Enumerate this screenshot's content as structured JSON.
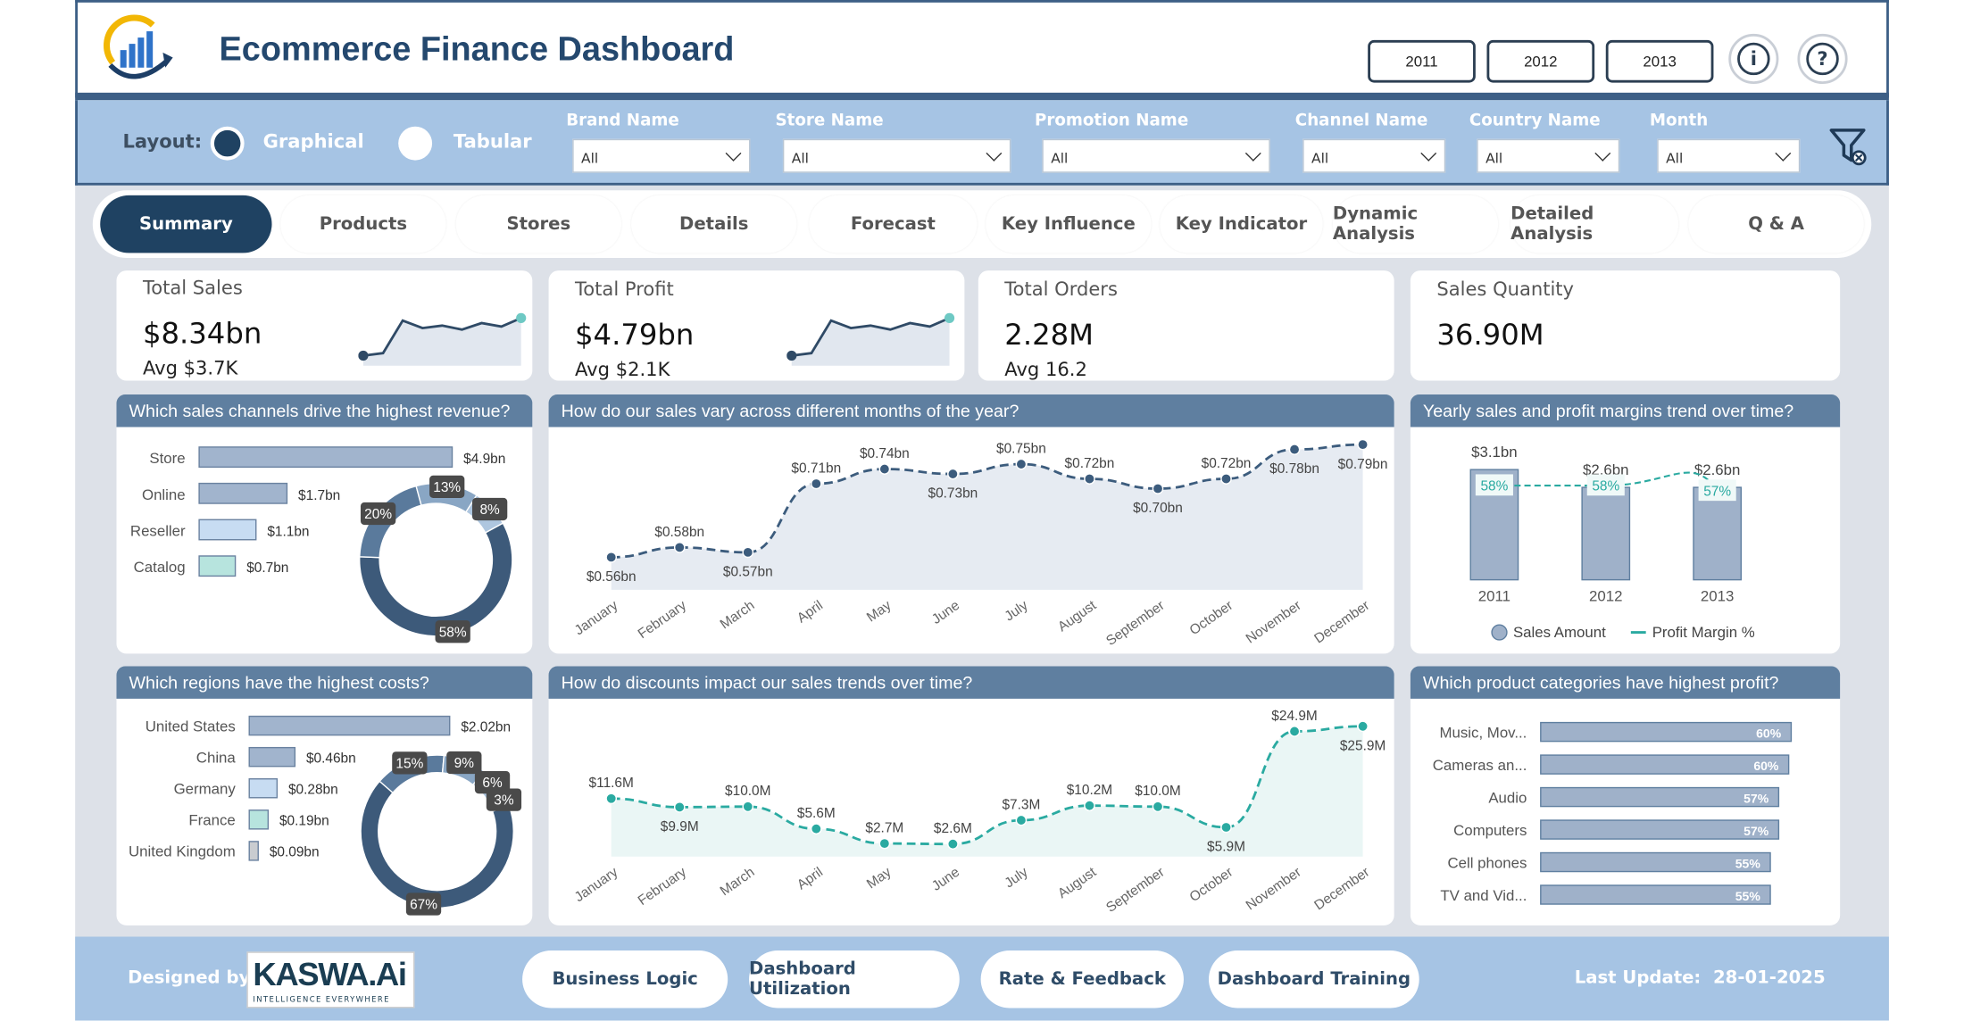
{
  "title": "Ecommerce Finance Dashboard",
  "years": [
    "2011",
    "2012",
    "2013"
  ],
  "icons": {
    "info": "i",
    "help": "?"
  },
  "layout": {
    "label": "Layout:",
    "graphical": "Graphical",
    "tabular": "Tabular"
  },
  "filters": [
    {
      "label": "Brand Name",
      "value": "All"
    },
    {
      "label": "Store Name",
      "value": "All"
    },
    {
      "label": "Promotion Name",
      "value": "All"
    },
    {
      "label": "Channel Name",
      "value": "All"
    },
    {
      "label": "Country Name",
      "value": "All"
    },
    {
      "label": "Month",
      "value": "All"
    }
  ],
  "tabs": [
    "Summary",
    "Products",
    "Stores",
    "Details",
    "Forecast",
    "Key Influence",
    "Key Indicator",
    "Dynamic Analysis",
    "Detailed Analysis",
    "Q & A"
  ],
  "kpis": [
    {
      "title": "Total Sales",
      "value": "$8.34bn",
      "avg_label": "Avg",
      "avg": "$3.7K"
    },
    {
      "title": "Total Profit",
      "value": "$4.79bn",
      "avg_label": "Avg",
      "avg": "$2.1K"
    },
    {
      "title": "Total Orders",
      "value": "2.28M",
      "avg_label": "Avg",
      "avg": "16.2"
    },
    {
      "title": "Sales Quantity",
      "value": "36.90M"
    }
  ],
  "panels": {
    "channels": "Which sales channels drive the highest revenue?",
    "months": "How do our sales vary across different months of the year?",
    "yearly": "Yearly sales and profit margins trend over time?",
    "regions": "Which regions have the highest costs?",
    "discounts": "How do discounts impact our sales trends over time?",
    "categories": "Which product categories have highest profit?"
  },
  "chart_data": [
    {
      "type": "bar",
      "id": "channels",
      "categories": [
        "Store",
        "Online",
        "Reseller",
        "Catalog"
      ],
      "values": [
        4.9,
        1.7,
        1.1,
        0.7
      ],
      "labels": [
        "$4.9bn",
        "$1.7bn",
        "$1.1bn",
        "$0.7bn"
      ],
      "colors": [
        "#a1b4cd",
        "#a1b4cd",
        "#c7dcf2",
        "#b7e4de"
      ]
    },
    {
      "type": "pie",
      "id": "channels-donut",
      "values": [
        58,
        20,
        13,
        8
      ],
      "labels": [
        "58%",
        "20%",
        "13%",
        "8%"
      ],
      "colors": [
        "#3d5a7a",
        "#5a7a9c",
        "#89a6c4",
        "#aec6df"
      ]
    },
    {
      "type": "area",
      "id": "months",
      "categories": [
        "January",
        "February",
        "March",
        "April",
        "May",
        "June",
        "July",
        "August",
        "September",
        "October",
        "November",
        "December"
      ],
      "values": [
        0.56,
        0.58,
        0.57,
        0.71,
        0.74,
        0.73,
        0.75,
        0.72,
        0.7,
        0.72,
        0.78,
        0.79
      ],
      "labels": [
        "$0.56bn",
        "$0.58bn",
        "$0.57bn",
        "$0.71bn",
        "$0.74bn",
        "$0.73bn",
        "$0.75bn",
        "$0.72bn",
        "$0.70bn",
        "$0.72bn",
        "$0.78bn",
        "$0.79bn"
      ]
    },
    {
      "type": "bar",
      "id": "yearly",
      "categories": [
        "2011",
        "2012",
        "2013"
      ],
      "series": [
        {
          "name": "Sales Amount",
          "values": [
            3.1,
            2.6,
            2.6
          ],
          "labels": [
            "$3.1bn",
            "$2.6bn",
            "$2.6bn"
          ]
        },
        {
          "name": "Profit Margin %",
          "values": [
            58,
            58,
            57
          ],
          "labels": [
            "58%",
            "58%",
            "57%"
          ]
        }
      ]
    },
    {
      "type": "bar",
      "id": "regions",
      "categories": [
        "United States",
        "China",
        "Germany",
        "France",
        "United Kingdom"
      ],
      "values": [
        2.02,
        0.46,
        0.28,
        0.19,
        0.09
      ],
      "labels": [
        "$2.02bn",
        "$0.46bn",
        "$0.28bn",
        "$0.19bn",
        "$0.09bn"
      ],
      "colors": [
        "#a1b4cd",
        "#a1b4cd",
        "#c7dcf2",
        "#b7e4de",
        "#c9ccd0"
      ]
    },
    {
      "type": "pie",
      "id": "regions-donut",
      "values": [
        67,
        15,
        9,
        6,
        3
      ],
      "labels": [
        "67%",
        "15%",
        "9%",
        "6%",
        "3%"
      ],
      "colors": [
        "#3d5a7a",
        "#5a7a9c",
        "#89a6c4",
        "#aec6df",
        "#c8dbee"
      ]
    },
    {
      "type": "area",
      "id": "discounts",
      "categories": [
        "January",
        "February",
        "March",
        "April",
        "May",
        "June",
        "July",
        "August",
        "September",
        "October",
        "November",
        "December"
      ],
      "values": [
        11.6,
        9.9,
        10.0,
        5.6,
        2.7,
        2.6,
        7.3,
        10.2,
        10.0,
        5.9,
        24.9,
        25.9
      ],
      "labels": [
        "$11.6M",
        "$9.9M",
        "$10.0M",
        "$5.6M",
        "$2.7M",
        "$2.6M",
        "$7.3M",
        "$10.2M",
        "$10.0M",
        "$5.9M",
        "$24.9M",
        "$25.9M"
      ]
    },
    {
      "type": "bar",
      "id": "categories",
      "categories": [
        "Music, Mov...",
        "Cameras an...",
        "Audio",
        "Computers",
        "Cell phones",
        "TV and Vid..."
      ],
      "values": [
        60,
        60,
        57,
        57,
        55,
        55
      ],
      "labels": [
        "60%",
        "60%",
        "57%",
        "57%",
        "55%",
        "55%"
      ]
    }
  ],
  "sparklines": {
    "sales": [
      0.2,
      0.25,
      0.9,
      0.75,
      0.8,
      0.72,
      0.85,
      0.78,
      0.95
    ],
    "profit": [
      0.2,
      0.25,
      0.9,
      0.75,
      0.8,
      0.72,
      0.85,
      0.78,
      0.95
    ]
  },
  "footer": {
    "designed_by": "Designed by:",
    "brand": "KASWA.Ai",
    "tagline": "INTELLIGENCE EVERYWHERE",
    "buttons": [
      "Business Logic",
      "Dashboard Utilization",
      "Rate & Feedback",
      "Dashboard Training"
    ],
    "last_update_label": "Last Update:",
    "last_update": "28-01-2025"
  }
}
